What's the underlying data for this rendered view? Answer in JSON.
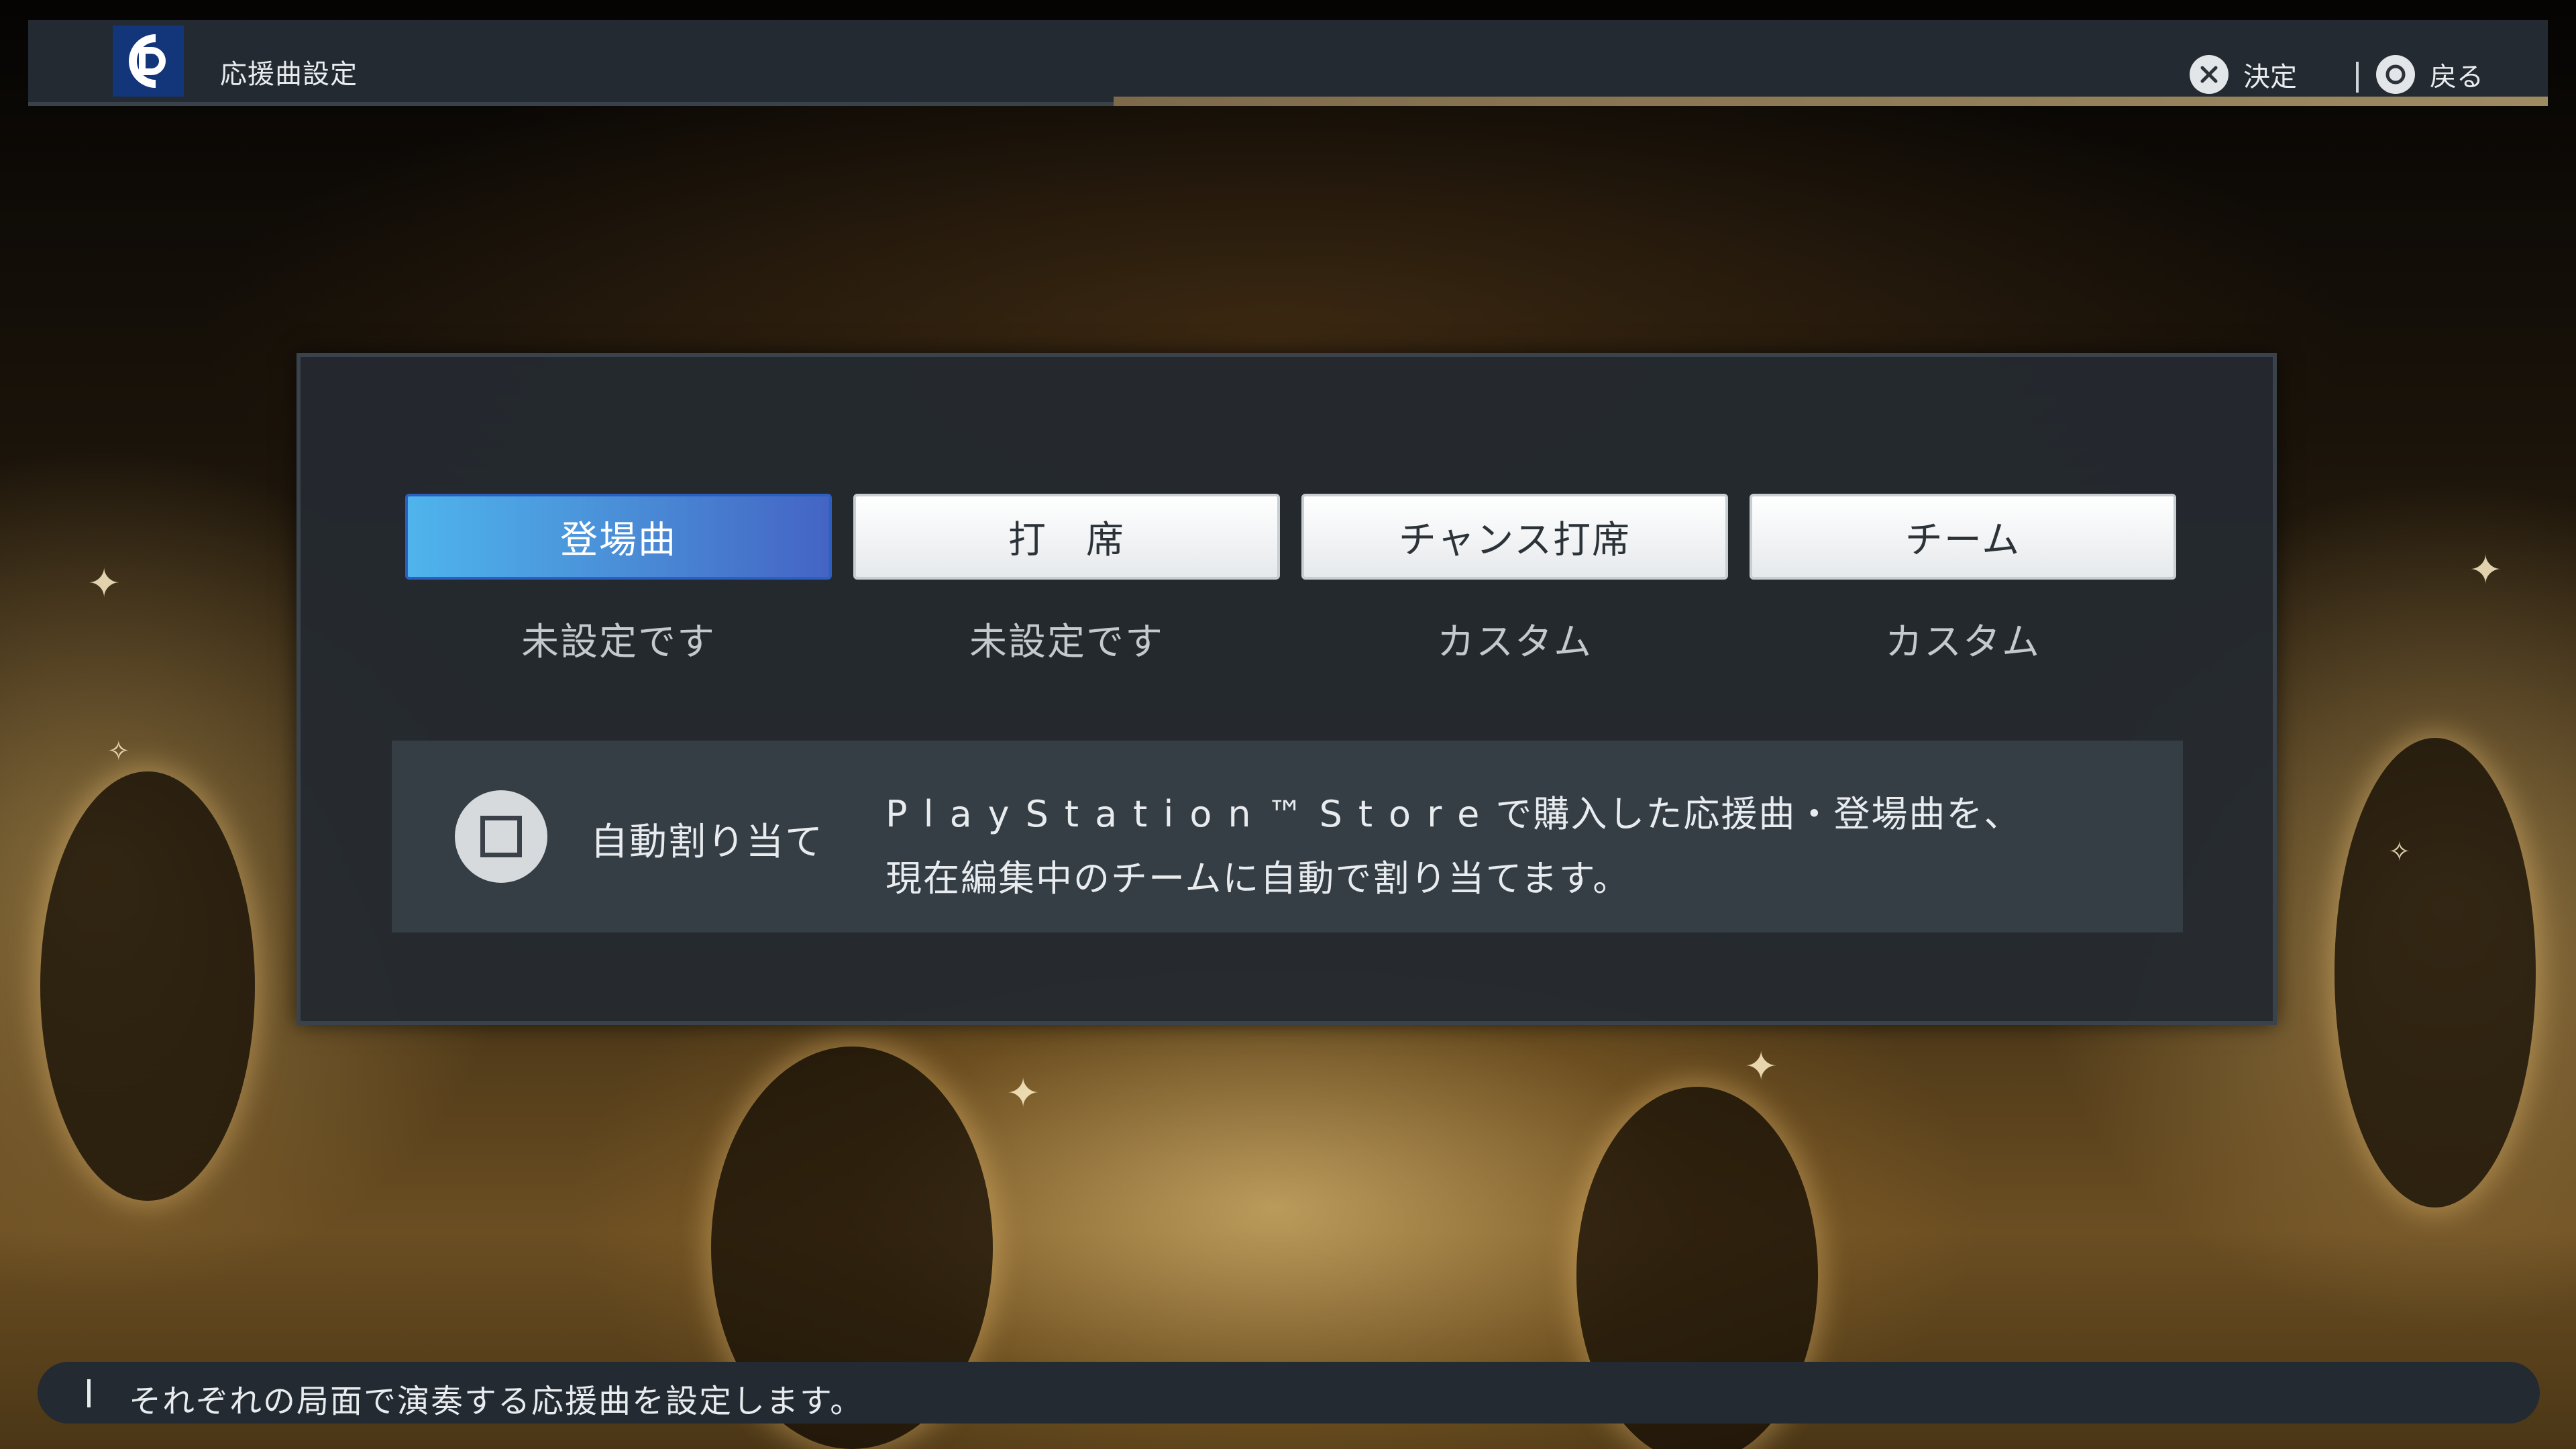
{
  "header": {
    "title": "応援曲設定",
    "team_logo_icon": "dragons-cd-logo-icon",
    "hints": [
      {
        "icon": "cross-button-icon",
        "label": "決定"
      },
      {
        "icon": "circle-button-icon",
        "label": "戻る"
      }
    ]
  },
  "tabs": [
    {
      "label": "登場曲",
      "status": "未設定です",
      "active": true
    },
    {
      "label": "打　席",
      "status": "未設定です",
      "active": false
    },
    {
      "label": "チャンス打席",
      "status": "カスタム",
      "active": false
    },
    {
      "label": "チーム",
      "status": "カスタム",
      "active": false
    }
  ],
  "auto_assign": {
    "icon": "square-button-icon",
    "label": "自動割り当て",
    "description_line1_latin": "PlayStation™Store",
    "description_line1_rest": "で購入した応援曲・登場曲を、",
    "description_line2": "現在編集中のチームに自動で割り当てます。"
  },
  "footer": {
    "help_text": "それぞれの局面で演奏する応援曲を設定します。"
  },
  "colors": {
    "active_tab_start": "#4fb4ec",
    "active_tab_end": "#4464c4",
    "panel_bg": "#242a30",
    "header_accent": "#a08a62",
    "team_logo_bg": "#13357a"
  }
}
